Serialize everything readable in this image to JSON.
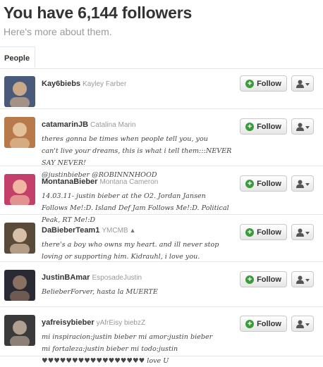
{
  "header": {
    "title": "You have 6,144 followers",
    "subtitle": "Here's more about them."
  },
  "tabs": [
    {
      "label": "People"
    }
  ],
  "follow_label": "Follow",
  "users": [
    {
      "username": "Kay6biebs",
      "realname": "Kayley Farber",
      "bio": [],
      "avatar_colors": [
        "#4a5a7a",
        "#c9a98a"
      ]
    },
    {
      "username": "catamarinJB",
      "realname": "Catalina Marin",
      "bio": [
        "theres gonna be times when people tell you, you",
        "can't live your dreams, this is what i tell them:::NEVER SAY NEVER!",
        "@justinbieber @ROBINNNHOOD"
      ],
      "avatar_colors": [
        "#b87a4a",
        "#e3c19a"
      ]
    },
    {
      "username": "MontanaBieber",
      "realname": "Montana Cameron",
      "bio": [
        "14.03.11- justin bieber at the O2. Jordan Jansen",
        "Follows Me!:D. Island Def Jam Follows Me!:D. Political Peak, RT Me!:D"
      ],
      "avatar_colors": [
        "#c2406a",
        "#f0b6a0"
      ]
    },
    {
      "username": "DaBieberTeam1",
      "realname": "YMCMB",
      "bio": [
        "there's a boy who owns my heart. and ill never stop",
        "loving or supporting him. Kidrauhl, i love you."
      ],
      "avatar_colors": [
        "#5a4a3a",
        "#d8c0a8"
      ]
    },
    {
      "username": "JustinBAmar",
      "realname": "EsposadeJustin",
      "bio": [
        "BelieberForver, hasta la MUERTE"
      ],
      "avatar_colors": [
        "#2a2a35",
        "#8a7060"
      ]
    },
    {
      "username": "yafreisybieber",
      "realname": "yAfrEisy biebzZ",
      "bio": [
        "mi inspiracion:justin bieber mi amor:justin bieber",
        "mi fortaleza:justin bieber mi todo:justin ♥♥♥♥♥♥♥♥♥♥♥♥♥♥♥♥♥ love U"
      ],
      "avatar_colors": [
        "#3a3a3a",
        "#b0a090"
      ]
    }
  ]
}
